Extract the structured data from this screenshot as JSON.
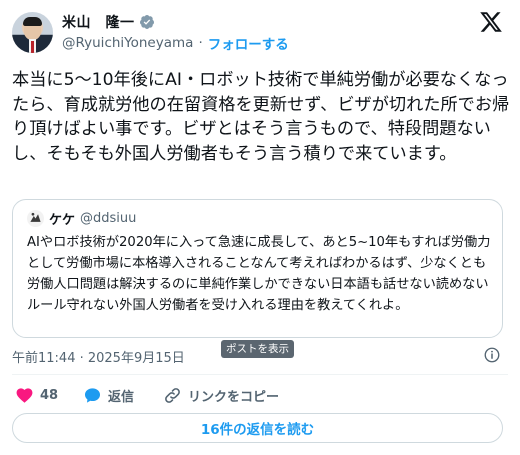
{
  "author": {
    "display_name": "米山　隆一",
    "handle": "@RyuichiYoneyama",
    "separator": "·",
    "follow_label": "フォローする",
    "verified": true
  },
  "tweet": {
    "text": "本当に5〜10年後にAI・ロボット技術で単純労働が必要なくなったら、育成就労他の在留資格を更新せず、ビザが切れた所でお帰り頂けばよい事です。ビザとはそう言うもので、特段問題ないし、そもそも外国人労働者もそう言う積りで来ています。"
  },
  "quote": {
    "display_name": "ケケ",
    "handle": "@ddsiuu",
    "text": "AIやロボ技術が2020年に入って急速に成長して、あと5~10年もすれば労働力として労働市場に本格導入されることなんて考えればわかるはず、少なくとも労働人口問題は解決するのに単純作業しかできない日本語も話せない読めないルール守れない外国人労働者を受け入れる理由を教えてくれよ。"
  },
  "meta": {
    "timestamp": "午前11:44 · 2025年9月15日",
    "tooltip": "ポストを表示"
  },
  "actions": {
    "like_count": "48",
    "reply_label": "返信",
    "copy_link_label": "リンクをコピー",
    "read_replies_label": "16件の返信を読む"
  },
  "colors": {
    "accent": "#1d9bf0",
    "like": "#f91880",
    "text": "#0f1419",
    "secondary": "#536471",
    "border": "#cfd9de"
  },
  "icons": {
    "verified": "verified-badge-icon",
    "brand": "x-logo-icon",
    "info": "info-icon",
    "like": "heart-icon",
    "reply": "speech-bubble-icon",
    "copy": "link-icon"
  }
}
